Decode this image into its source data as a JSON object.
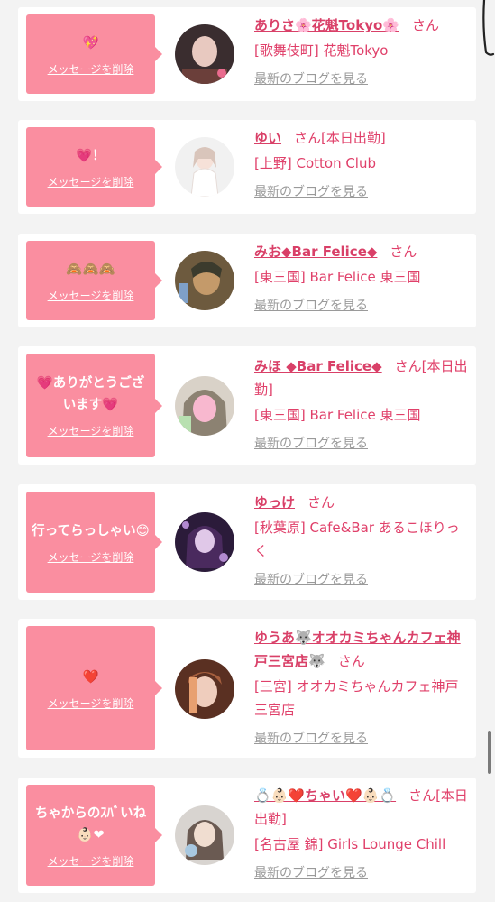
{
  "common": {
    "delete_label": "メッセージを削除",
    "san": "さん",
    "blog_label": "最新のブログを見る"
  },
  "cards": [
    {
      "message": "💖",
      "name": "ありさ🌸花魁Tokyo🌸",
      "suffix": "",
      "shop": "[歌舞伎町] 花魁Tokyo",
      "avatar_colors": [
        "#3a2d2f",
        "#e8c9c0",
        "#6b3f3a"
      ]
    },
    {
      "message": "💗！",
      "name": "ゆい",
      "suffix": "[本日出勤]",
      "shop": "[上野] Cotton Club",
      "avatar_colors": [
        "#f1f1f1",
        "#f6e1d8",
        "#d9c5bb"
      ]
    },
    {
      "message": "🙈🙈🙈",
      "name": "みお◆Bar Felice◆",
      "suffix": "",
      "shop": "[東三国] Bar Felice 東三国",
      "avatar_colors": [
        "#6d5a3e",
        "#c49a6a",
        "#3b3b2d"
      ]
    },
    {
      "message": "💗ありがとうございます💗",
      "name": "みほ ◆Bar Felice◆",
      "suffix": "[本日出勤]",
      "shop": "[東三国] Bar Felice 東三国",
      "avatar_colors": [
        "#d9d2c8",
        "#f8b8cf",
        "#8c8272"
      ]
    },
    {
      "message": "行ってらっしゃい😊",
      "name": "ゆっけ",
      "suffix": "",
      "shop": "[秋葉原] Cafe&Bar あるこほりっく",
      "avatar_colors": [
        "#2b1b3a",
        "#b28ad0",
        "#e0c8e8"
      ]
    },
    {
      "message": "❤️",
      "name": "ゆうあ🐺オオカミちゃんカフェ神戸三宮店🐺",
      "suffix": "",
      "shop": "[三宮] オオカミちゃんカフェ神戸三宮店",
      "avatar_colors": [
        "#5a3022",
        "#efcdbd",
        "#a65f3e"
      ]
    },
    {
      "message": "ちゃからのｽﾊﾞいね👶🏻❤",
      "name": "💍👶🏻❤️ちゃい❤️👶🏻💍",
      "suffix": "[本日出勤]",
      "shop": "[名古屋 錦] Girls Lounge Chill",
      "avatar_colors": [
        "#d8d4d0",
        "#f0ddd0",
        "#6a5a52"
      ]
    }
  ]
}
